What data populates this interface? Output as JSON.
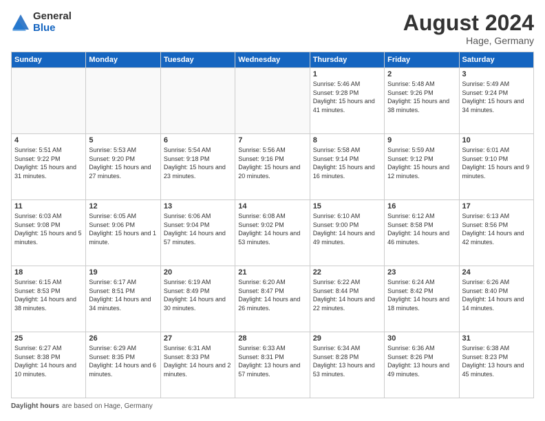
{
  "logo": {
    "general": "General",
    "blue": "Blue"
  },
  "header": {
    "month_year": "August 2024",
    "location": "Hage, Germany"
  },
  "days_of_week": [
    "Sunday",
    "Monday",
    "Tuesday",
    "Wednesday",
    "Thursday",
    "Friday",
    "Saturday"
  ],
  "weeks": [
    [
      {
        "day": "",
        "info": ""
      },
      {
        "day": "",
        "info": ""
      },
      {
        "day": "",
        "info": ""
      },
      {
        "day": "",
        "info": ""
      },
      {
        "day": "1",
        "info": "Sunrise: 5:46 AM\nSunset: 9:28 PM\nDaylight: 15 hours and 41 minutes."
      },
      {
        "day": "2",
        "info": "Sunrise: 5:48 AM\nSunset: 9:26 PM\nDaylight: 15 hours and 38 minutes."
      },
      {
        "day": "3",
        "info": "Sunrise: 5:49 AM\nSunset: 9:24 PM\nDaylight: 15 hours and 34 minutes."
      }
    ],
    [
      {
        "day": "4",
        "info": "Sunrise: 5:51 AM\nSunset: 9:22 PM\nDaylight: 15 hours and 31 minutes."
      },
      {
        "day": "5",
        "info": "Sunrise: 5:53 AM\nSunset: 9:20 PM\nDaylight: 15 hours and 27 minutes."
      },
      {
        "day": "6",
        "info": "Sunrise: 5:54 AM\nSunset: 9:18 PM\nDaylight: 15 hours and 23 minutes."
      },
      {
        "day": "7",
        "info": "Sunrise: 5:56 AM\nSunset: 9:16 PM\nDaylight: 15 hours and 20 minutes."
      },
      {
        "day": "8",
        "info": "Sunrise: 5:58 AM\nSunset: 9:14 PM\nDaylight: 15 hours and 16 minutes."
      },
      {
        "day": "9",
        "info": "Sunrise: 5:59 AM\nSunset: 9:12 PM\nDaylight: 15 hours and 12 minutes."
      },
      {
        "day": "10",
        "info": "Sunrise: 6:01 AM\nSunset: 9:10 PM\nDaylight: 15 hours and 9 minutes."
      }
    ],
    [
      {
        "day": "11",
        "info": "Sunrise: 6:03 AM\nSunset: 9:08 PM\nDaylight: 15 hours and 5 minutes."
      },
      {
        "day": "12",
        "info": "Sunrise: 6:05 AM\nSunset: 9:06 PM\nDaylight: 15 hours and 1 minute."
      },
      {
        "day": "13",
        "info": "Sunrise: 6:06 AM\nSunset: 9:04 PM\nDaylight: 14 hours and 57 minutes."
      },
      {
        "day": "14",
        "info": "Sunrise: 6:08 AM\nSunset: 9:02 PM\nDaylight: 14 hours and 53 minutes."
      },
      {
        "day": "15",
        "info": "Sunrise: 6:10 AM\nSunset: 9:00 PM\nDaylight: 14 hours and 49 minutes."
      },
      {
        "day": "16",
        "info": "Sunrise: 6:12 AM\nSunset: 8:58 PM\nDaylight: 14 hours and 46 minutes."
      },
      {
        "day": "17",
        "info": "Sunrise: 6:13 AM\nSunset: 8:56 PM\nDaylight: 14 hours and 42 minutes."
      }
    ],
    [
      {
        "day": "18",
        "info": "Sunrise: 6:15 AM\nSunset: 8:53 PM\nDaylight: 14 hours and 38 minutes."
      },
      {
        "day": "19",
        "info": "Sunrise: 6:17 AM\nSunset: 8:51 PM\nDaylight: 14 hours and 34 minutes."
      },
      {
        "day": "20",
        "info": "Sunrise: 6:19 AM\nSunset: 8:49 PM\nDaylight: 14 hours and 30 minutes."
      },
      {
        "day": "21",
        "info": "Sunrise: 6:20 AM\nSunset: 8:47 PM\nDaylight: 14 hours and 26 minutes."
      },
      {
        "day": "22",
        "info": "Sunrise: 6:22 AM\nSunset: 8:44 PM\nDaylight: 14 hours and 22 minutes."
      },
      {
        "day": "23",
        "info": "Sunrise: 6:24 AM\nSunset: 8:42 PM\nDaylight: 14 hours and 18 minutes."
      },
      {
        "day": "24",
        "info": "Sunrise: 6:26 AM\nSunset: 8:40 PM\nDaylight: 14 hours and 14 minutes."
      }
    ],
    [
      {
        "day": "25",
        "info": "Sunrise: 6:27 AM\nSunset: 8:38 PM\nDaylight: 14 hours and 10 minutes."
      },
      {
        "day": "26",
        "info": "Sunrise: 6:29 AM\nSunset: 8:35 PM\nDaylight: 14 hours and 6 minutes."
      },
      {
        "day": "27",
        "info": "Sunrise: 6:31 AM\nSunset: 8:33 PM\nDaylight: 14 hours and 2 minutes."
      },
      {
        "day": "28",
        "info": "Sunrise: 6:33 AM\nSunset: 8:31 PM\nDaylight: 13 hours and 57 minutes."
      },
      {
        "day": "29",
        "info": "Sunrise: 6:34 AM\nSunset: 8:28 PM\nDaylight: 13 hours and 53 minutes."
      },
      {
        "day": "30",
        "info": "Sunrise: 6:36 AM\nSunset: 8:26 PM\nDaylight: 13 hours and 49 minutes."
      },
      {
        "day": "31",
        "info": "Sunrise: 6:38 AM\nSunset: 8:23 PM\nDaylight: 13 hours and 45 minutes."
      }
    ]
  ],
  "footer": {
    "label": "Daylight hours",
    "note": "are based on Hage, Germany"
  }
}
